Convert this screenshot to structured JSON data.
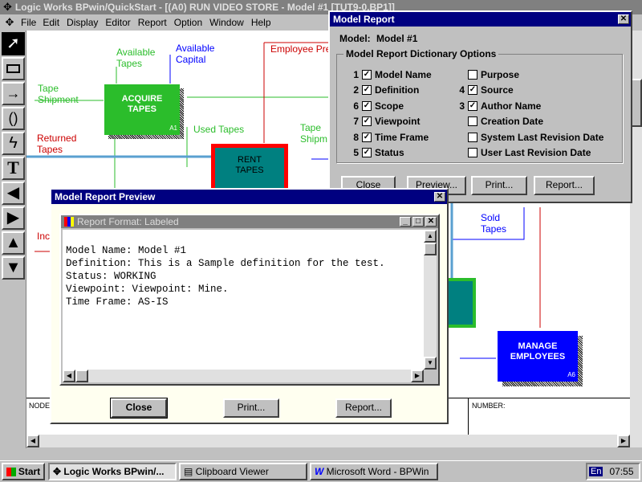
{
  "app": {
    "title": "Logic Works BPwin/QuickStart - [(A0) RUN VIDEO STORE - Model #1  [TUT9-0.BP1]]",
    "menu": [
      "File",
      "Edit",
      "Display",
      "Editor",
      "Report",
      "Option",
      "Window",
      "Help"
    ]
  },
  "diagram": {
    "boxes": [
      {
        "title": "ACQUIRE\nTAPES",
        "num": "A1",
        "color": "#2bbd2b"
      },
      {
        "title": "RENT\nTAPES",
        "num": "",
        "color": "#008080",
        "border": "#ff0000"
      },
      {
        "title": "MANAGE\nEMPLOYEES",
        "num": "A6",
        "color": "#0000ff"
      }
    ],
    "labels": {
      "available_tapes": "Available\nTapes",
      "available_capital": "Available\nCapital",
      "employee_pre": "Employee Pre",
      "tape_shipment": "Tape\nShipment",
      "returned_tapes": "Returned\nTapes",
      "used_tapes": "Used Tapes",
      "tape_shipm2": "Tape\nShipm",
      "sold_tapes": "Sold\nTapes",
      "inc": "Inc",
      "node": "NODE",
      "number": "NUMBER:"
    }
  },
  "model_report": {
    "title": "Model Report",
    "model_label": "Model:",
    "model_value": "Model #1",
    "group_title": "Model Report Dictionary Options",
    "left_options": [
      {
        "order": "1",
        "label": "Model Name",
        "checked": true
      },
      {
        "order": "2",
        "label": "Definition",
        "checked": true
      },
      {
        "order": "6",
        "label": "Scope",
        "checked": true
      },
      {
        "order": "7",
        "label": "Viewpoint",
        "checked": true
      },
      {
        "order": "8",
        "label": "Time Frame",
        "checked": true
      },
      {
        "order": "5",
        "label": "Status",
        "checked": true
      }
    ],
    "right_options": [
      {
        "order": "",
        "label": "Purpose",
        "checked": false
      },
      {
        "order": "4",
        "label": "Source",
        "checked": true
      },
      {
        "order": "3",
        "label": "Author Name",
        "checked": true
      },
      {
        "order": "",
        "label": "Creation Date",
        "checked": false
      },
      {
        "order": "",
        "label": "System Last Revision Date",
        "checked": false
      },
      {
        "order": "",
        "label": "User Last Revision Date",
        "checked": false
      }
    ],
    "buttons": {
      "close": "Close",
      "preview": "Preview...",
      "print": "Print...",
      "report": "Report..."
    }
  },
  "preview": {
    "title": "Model Report Preview",
    "inner_title": "Report Format: Labeled",
    "lines": [
      "Model Name: Model #1",
      "Definition: This is a Sample definition for the test.",
      "Status: WORKING",
      "Viewpoint: Viewpoint: Mine.",
      "Time Frame: AS-IS"
    ],
    "buttons": {
      "close": "Close",
      "print": "Print...",
      "report": "Report..."
    }
  },
  "taskbar": {
    "start": "Start",
    "items": [
      "Logic Works BPwin/...",
      "Clipboard Viewer",
      "Microsoft Word - BPWin"
    ],
    "lang": "En",
    "clock": "07:55"
  }
}
